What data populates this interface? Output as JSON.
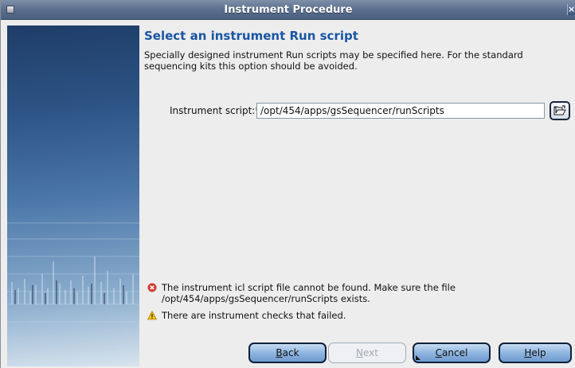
{
  "window": {
    "title": "Instrument Procedure",
    "close_glyph": "×"
  },
  "main": {
    "heading": "Select an instrument Run script",
    "description": "Specially designed instrument Run scripts may be specified here. For the standard sequencing kits this option should be avoided.",
    "script_label": "Instrument script:*",
    "script_value": "/opt/454/apps/gsSequencer/runScripts"
  },
  "messages": {
    "error_text": "The instrument icl script file cannot be found. Make sure the file /opt/454/apps/gsSequencer/runScripts exists.",
    "warning_text": "There are instrument checks that failed."
  },
  "buttons": {
    "back_mnemonic": "B",
    "back_rest": "ack",
    "next_mnemonic": "N",
    "next_rest": "ext",
    "cancel_mnemonic": "C",
    "cancel_rest": "ancel",
    "help_mnemonic": "H",
    "help_rest": "elp",
    "next_enabled": false
  },
  "icons": {
    "browse": "folder-open-icon",
    "error": "error-icon",
    "warning": "warning-icon"
  },
  "colors": {
    "heading": "#1a55a3",
    "error": "#d13a32",
    "warning": "#f2c20f",
    "titlebar": "#5d7190"
  }
}
